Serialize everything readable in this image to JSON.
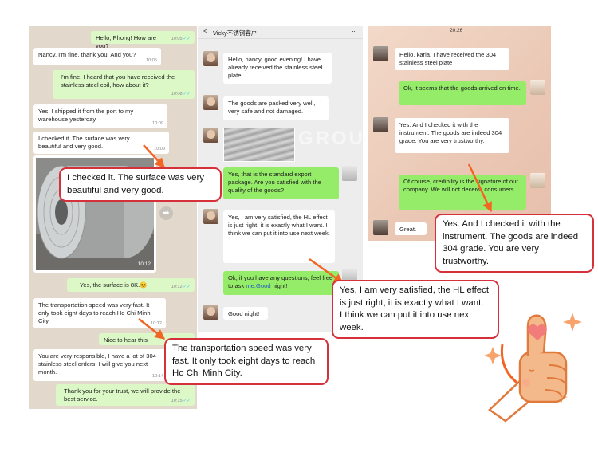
{
  "whatsapp": {
    "messages": [
      {
        "text": "Hello, Phong! How are you?",
        "time": "10:05"
      },
      {
        "text": "Nancy, I'm fine, thank you. And you?",
        "time": "10:05"
      },
      {
        "text": "I'm fine. I heard that you have received the stainless steel coil, how about it?",
        "time": "10:08"
      },
      {
        "text": "Yes, I shipped it from the port to my warehouse yesterday.",
        "time": "10:09"
      },
      {
        "text": "I checked it. The surface was very beautiful and very good.",
        "time": "10:09"
      },
      {
        "text": "Yes, the surface is 8K.😊",
        "time": "10:12"
      },
      {
        "text": "The transportation speed was very fast. It only took eight days to reach Ho Chi Minh City.",
        "time": "10:12"
      },
      {
        "text": "Nice to hear this",
        "time": ""
      },
      {
        "text": "You are very responsible, I have a lot of 304 stainless steel orders. I will give you next month.",
        "time": "10:14"
      },
      {
        "text": "Thank you for your trust, we will provide the best service.",
        "time": "10:15"
      }
    ],
    "video_duration": "10:12"
  },
  "wechat": {
    "header_title": "Vicky不锈钢客户",
    "back_glyph": "<",
    "more_glyph": "···",
    "messages": [
      {
        "text": "Hello, nancy, good evening! I have already received the stainless steel plate."
      },
      {
        "text": "The goods are packed very well, very safe and not damaged."
      },
      {
        "text": "Yes, that is the standard export package. Are you satisfied with the quality of the goods?"
      },
      {
        "text": "Yes, I am very satisfied, the HL effect is just right, it is exactly what I want. I think we can put it into use next week."
      },
      {
        "text_before": "Ok, if you have any questions, feel free to ask ",
        "link": "me.Good",
        "text_after": " night!"
      },
      {
        "text": "Good night!"
      }
    ],
    "watermark": "GROUP"
  },
  "chat3": {
    "time": "20:26",
    "messages": [
      {
        "text": "Hello, karla, I have received the 304 stainless steel plate"
      },
      {
        "text": "Ok, it seems that the goods arrived on time."
      },
      {
        "text": "Yes. And I checked it with the instrument. The goods are indeed 304 grade. You are very trustworthy."
      },
      {
        "text": "Of course, credibility is the signature of our company. We will not deceive consumers."
      },
      {
        "text": "Great."
      }
    ]
  },
  "callouts": {
    "surface": "I checked it. The surface was very beautiful and very good.",
    "transport": "The transportation speed was very fast. It only took eight days to reach Ho Chi Minh City.",
    "hl": "Yes, I am very satisfied, the HL effect is just right, it is exactly what I want.",
    "hl2": "I think we can put it into use next week.",
    "instrument": "Yes. And I checked it with the instrument. The goods are indeed 304 grade. You are very trustworthy."
  },
  "colors": {
    "accent_red": "#d6303a",
    "whatsapp_out": "#dcf8c6",
    "wechat_green": "#95ec69",
    "arrow_orange": "#f26522",
    "thumb": "#f4b98a"
  }
}
